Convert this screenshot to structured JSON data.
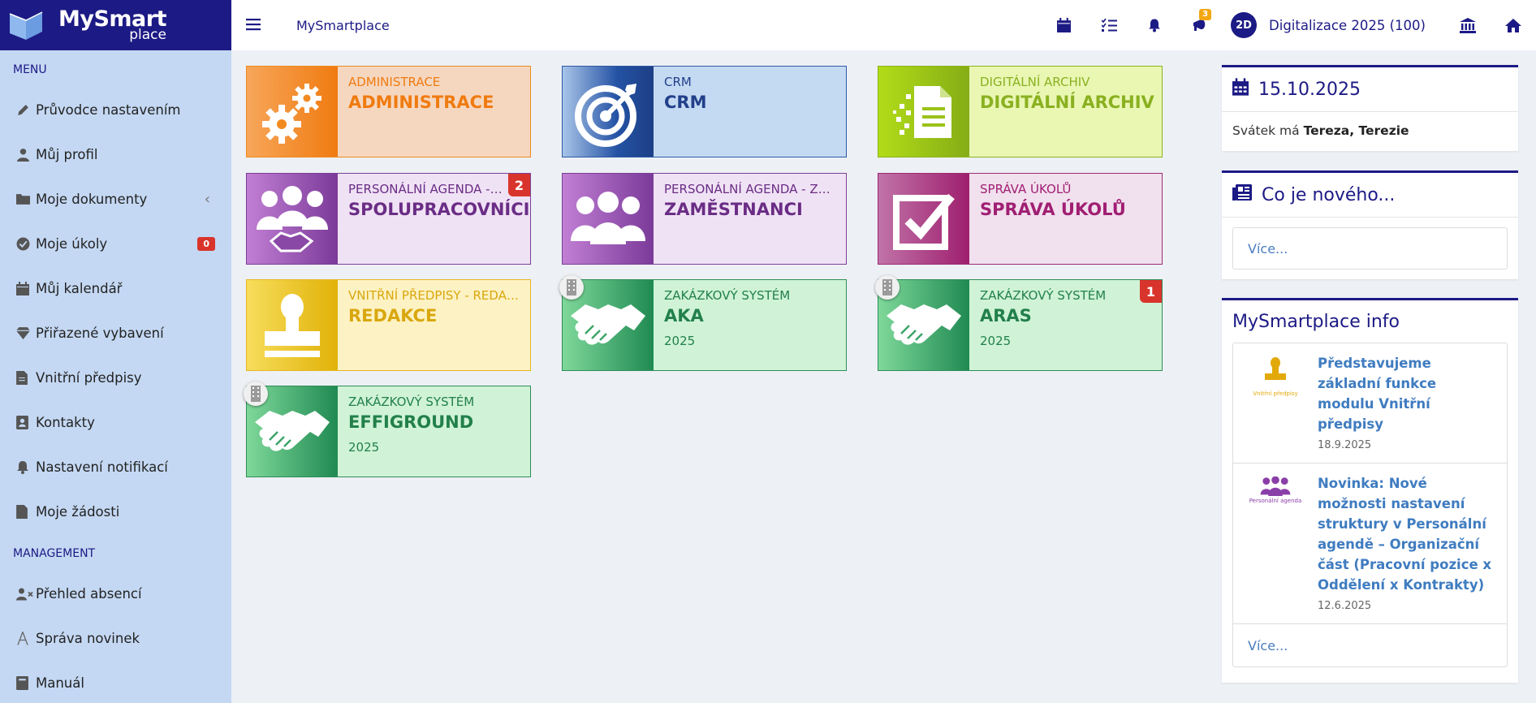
{
  "brand": {
    "logo_line1": "MySmart",
    "logo_line2": "place"
  },
  "topbar": {
    "brand_link": "MySmartplace",
    "notif_badge": "3",
    "avatar_initials": "2D",
    "user_name": "Digitalizace 2025 (100)"
  },
  "sidebar": {
    "section_menu": "MENU",
    "section_management": "MANAGEMENT",
    "items": [
      {
        "label": "Průvodce nastavením",
        "icon": "pencil-icon"
      },
      {
        "label": "Můj profil",
        "icon": "user-icon"
      },
      {
        "label": "Moje dokumenty",
        "icon": "folder-icon"
      },
      {
        "label": "Moje úkoly",
        "icon": "check-circle-icon",
        "badge": "0"
      },
      {
        "label": "Můj kalendář",
        "icon": "calendar-icon"
      },
      {
        "label": "Přiřazené vybavení",
        "icon": "diamond-icon"
      },
      {
        "label": "Vnitřní předpisy",
        "icon": "document-icon"
      },
      {
        "label": "Kontakty",
        "icon": "contact-card-icon"
      },
      {
        "label": "Nastavení notifikací",
        "icon": "bell-icon"
      },
      {
        "label": "Moje žádosti",
        "icon": "document-icon"
      }
    ],
    "mgmt_items": [
      {
        "label": "Přehled absencí",
        "icon": "user-x-icon"
      },
      {
        "label": "Správa novinek",
        "icon": "font-icon"
      },
      {
        "label": "Manuál",
        "icon": "book-icon"
      }
    ]
  },
  "tiles": [
    {
      "sub": "ADMINISTRACE",
      "title": "ADMINISTRACE",
      "icon": "gears-icon",
      "color": "#f07b10"
    },
    {
      "sub": "CRM",
      "title": "CRM",
      "icon": "target-icon",
      "color": "#22408a"
    },
    {
      "sub": "DIGITÁLNÍ ARCHIV",
      "title": "DIGITÁLNÍ ARCHIV",
      "icon": "digital-document-icon",
      "color": "#8ab020"
    },
    {
      "sub": "PERSONÁLNÍ AGENDA - SPOLUPRACOVNÍCI",
      "title": "SPOLUPRACOVNÍCI",
      "badge": "2",
      "icon": "handshake-group-icon",
      "color": "#6a2d85"
    },
    {
      "sub": "PERSONÁLNÍ AGENDA - ZAMĚSTNANCI",
      "title": "ZAMĚSTNANCI",
      "icon": "group-icon",
      "color": "#6a2d85"
    },
    {
      "sub": "SPRÁVA ÚKOLŮ",
      "title": "SPRÁVA ÚKOLŮ",
      "icon": "checkbox-icon",
      "color": "#a01f72"
    },
    {
      "sub": "VNITŘNÍ PŘEDPISY - REDAKCE",
      "title": "REDAKCE",
      "icon": "stamp-icon",
      "color": "#d9a70d"
    },
    {
      "sub": "ZAKÁZKOVÝ SYSTÉM",
      "title": "AKA",
      "year": "2025",
      "icon": "handshake-icon",
      "color": "#22804b"
    },
    {
      "sub": "ZAKÁZKOVÝ SYSTÉM",
      "title": "ARAS",
      "year": "2025",
      "badge": "1",
      "icon": "handshake-icon",
      "color": "#22804b"
    },
    {
      "sub": "ZAKÁZKOVÝ SYSTÉM",
      "title": "EFFIGROUND",
      "year": "2025",
      "icon": "handshake-icon",
      "color": "#22804b"
    }
  ],
  "date_panel": {
    "date": "15.10.2025",
    "holiday_prefix": "Svátek má",
    "holiday_names": "Tereza, Terezie"
  },
  "news_panel": {
    "title": "Co je nového...",
    "more": "Více..."
  },
  "info_panel": {
    "title": "MySmartplace info",
    "items": [
      {
        "title": "Představujeme základní funkce modulu Vnitřní předpisy",
        "date": "18.9.2025",
        "thumb_caption": "Vnitřní předpisy"
      },
      {
        "title": "Novinka: Nové možnosti nastavení struktury v Personální agendě – Organizační část (Pracovní pozice x Oddělení x Kontrakty)",
        "date": "12.6.2025",
        "thumb_caption": "Personální agenda"
      }
    ],
    "more": "Více..."
  },
  "colors": {
    "primary": "#1c1a85",
    "sidebar_bg": "#c4d8f3",
    "badge_red": "#d9342b",
    "badge_orange": "#f3a712",
    "link": "#3f7cc0"
  }
}
